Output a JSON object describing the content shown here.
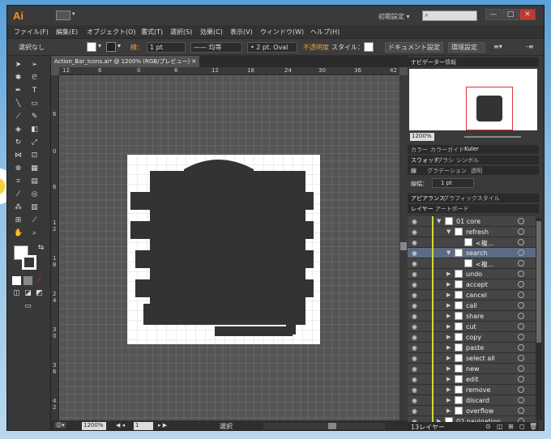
{
  "app": {
    "logo": "Ai",
    "workspace": "初期設定",
    "search_placeholder": ""
  },
  "window_buttons": [
    "—",
    "□",
    "✕"
  ],
  "menu": [
    "ファイル(F)",
    "編集(E)",
    "オブジェクト(O)",
    "書式(T)",
    "選択(S)",
    "効果(C)",
    "表示(V)",
    "ウィンドウ(W)",
    "ヘルプ(H)"
  ],
  "control": {
    "selection": "選択なし",
    "stroke_label": "線：",
    "stroke_weight": "1 pt",
    "profile": "均等",
    "brush": "2 pt. Oval",
    "opacity_label": "不透明度",
    "style_label": "スタイル：",
    "doc_setup": "ドキュメント設定",
    "prefs": "環境設定"
  },
  "document": {
    "tab": "Action_Bar_Icons.ai* @ 1200% (RGB/プレビュー)",
    "ruler_h": [
      "12",
      "6",
      "0",
      "6",
      "12",
      "18",
      "24",
      "30",
      "36",
      "42"
    ],
    "ruler_v": [
      "6",
      "0",
      "6",
      "1 2",
      "1 8",
      "2 4",
      "3 0",
      "3 6",
      "4 2"
    ],
    "zoom": "1200%",
    "page": "1",
    "status_text": "選択"
  },
  "navigator": {
    "tabs": [
      "ナビゲーター",
      "情報"
    ],
    "zoom": "1200%"
  },
  "panel_tabs": {
    "color": [
      "カラー",
      "カラーガイド",
      "Kuler"
    ],
    "swatch": [
      "スウォッチ",
      "ブラシ",
      "シンボル"
    ],
    "stroke": [
      "線",
      "グラデーション",
      "透明"
    ],
    "stroke_weight_label": "線幅：",
    "stroke_weight": "1 pt",
    "appearance": [
      "アピアランス",
      "グラフィックスタイル"
    ],
    "layers": [
      "レイヤー",
      "アートボード"
    ]
  },
  "layers": [
    {
      "name": "01 core",
      "indent": 0,
      "expanded": true,
      "thumb": "folder"
    },
    {
      "name": "refresh",
      "indent": 1,
      "expanded": true,
      "thumb": "refresh"
    },
    {
      "name": "<複...",
      "indent": 2,
      "expanded": null,
      "thumb": "refresh"
    },
    {
      "name": "search",
      "indent": 1,
      "expanded": true,
      "thumb": "search",
      "selected": true
    },
    {
      "name": "<複...",
      "indent": 2,
      "expanded": null,
      "thumb": "search"
    },
    {
      "name": "undo",
      "indent": 1,
      "expanded": false,
      "thumb": "undo"
    },
    {
      "name": "accept",
      "indent": 1,
      "expanded": false,
      "thumb": "accept"
    },
    {
      "name": "cancel",
      "indent": 1,
      "expanded": false,
      "thumb": "cancel"
    },
    {
      "name": "call",
      "indent": 1,
      "expanded": false,
      "thumb": "call"
    },
    {
      "name": "share",
      "indent": 1,
      "expanded": false,
      "thumb": "share"
    },
    {
      "name": "cut",
      "indent": 1,
      "expanded": false,
      "thumb": "cut"
    },
    {
      "name": "copy",
      "indent": 1,
      "expanded": false,
      "thumb": "copy"
    },
    {
      "name": "paste",
      "indent": 1,
      "expanded": false,
      "thumb": "paste"
    },
    {
      "name": "select all",
      "indent": 1,
      "expanded": false,
      "thumb": "select-all"
    },
    {
      "name": "new",
      "indent": 1,
      "expanded": false,
      "thumb": "new"
    },
    {
      "name": "edit",
      "indent": 1,
      "expanded": false,
      "thumb": "edit"
    },
    {
      "name": "remove",
      "indent": 1,
      "expanded": false,
      "thumb": "remove"
    },
    {
      "name": "discard",
      "indent": 1,
      "expanded": false,
      "thumb": "discard"
    },
    {
      "name": "overflow",
      "indent": 1,
      "expanded": false,
      "thumb": "overflow"
    },
    {
      "name": "02 navigation",
      "indent": 0,
      "expanded": false,
      "thumb": "folder"
    }
  ],
  "layer_count": "13レイヤー"
}
